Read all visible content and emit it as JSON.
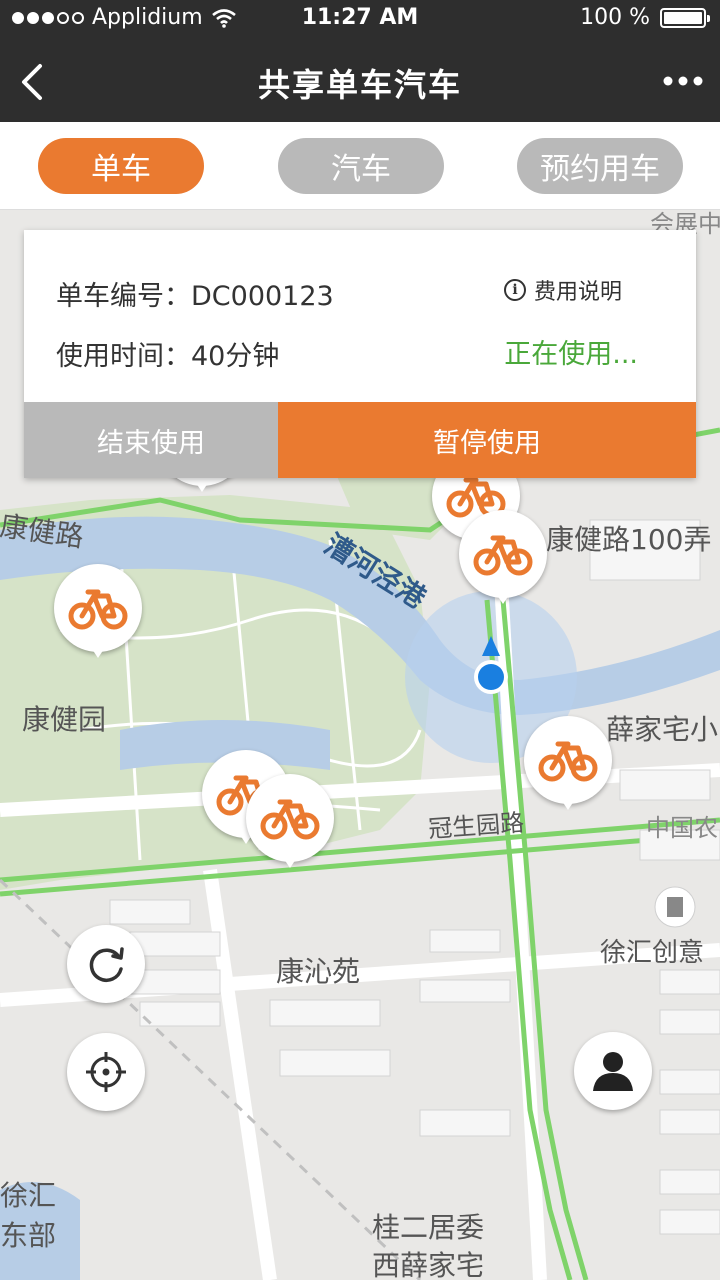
{
  "status_bar": {
    "carrier": "Applidium",
    "time": "11:27 AM",
    "battery": "100 %"
  },
  "nav": {
    "title": "共享单车汽车",
    "back_icon": "chevron-left-icon",
    "more_icon": "more-dots-icon"
  },
  "tabs": [
    {
      "label": "单车",
      "active": true
    },
    {
      "label": "汽车",
      "active": false
    },
    {
      "label": "预约用车",
      "active": false
    }
  ],
  "card": {
    "bike_id_label": "单车编号：DC000123",
    "usage_time_label": "使用时间：40分钟",
    "fee_label": "费用说明",
    "status": "正在使用...",
    "end_button": "结束使用",
    "pause_button": "暂停使用"
  },
  "map": {
    "labels": {
      "kangjian_road": "康健路",
      "kangjian_road_100": "康健路100弄",
      "caohe_port": "漕河泾港",
      "kangjian_garden": "康健园",
      "xuejia_zhai": "薛家宅小",
      "guansheng_road": "冠生园路",
      "zhongguo": "中国农",
      "xuhui_chuangyi": "徐汇创意",
      "kangqin_yuan": "康沁苑",
      "xuhui_dongbu_1": "徐汇",
      "xuhui_dongbu_2": "东部",
      "guier_juwei": "桂二居委",
      "xixue_jiazhai": "西薛家宅",
      "huizhan": "会展中"
    },
    "bike_pin_count": 7
  },
  "floating": {
    "refresh_icon": "refresh-icon",
    "locate_icon": "locate-crosshair-icon",
    "profile_icon": "person-icon"
  },
  "colors": {
    "accent": "#ea7a30",
    "inactive": "#b9b9b9",
    "active_status": "#4aa83a",
    "topbar": "#2e2e2e"
  }
}
